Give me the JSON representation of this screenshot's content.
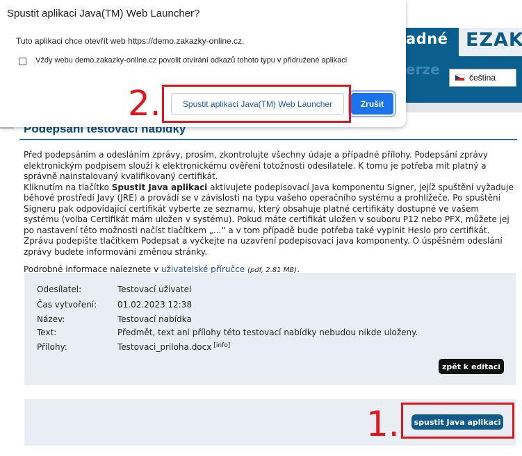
{
  "dialog": {
    "title": "Spustit aplikaci Java(TM) Web Launcher?",
    "message": "Tuto aplikaci chce otevřít web https://demo.zakazky-online.cz.",
    "checkbox_label": "Vždy webu demo.zakazky-online.cz povolit otvírání odkazů tohoto typu v přidružené aplikaci",
    "checkbox_checked": false,
    "open_button": "Spustit aplikaci Java(TM) Web Launcher",
    "cancel_button": "Zrušit"
  },
  "header": {
    "title_fragment": "adné",
    "subtitle_fragment": "erze",
    "logo_text": "EZAK",
    "language": "čeština"
  },
  "page": {
    "title": "Podepsání testovací nabídky",
    "intro": "Před podepsáním a odesláním zprávy, prosím, zkontrolujte všechny údaje a případné přílohy. Podepsání zprávy elektronickým podpisem slouží k elektronickému ověření totožnosti odesilatele. K tomu je potřeba mít platný a správně nainstalovaný kvalifikovaný certifikát.",
    "instr_before": "Kliknutím na tlačítko ",
    "instr_bold": "Spustit Java aplikaci",
    "instr_after": " aktivujete podepisovací Java komponentu Signer, jejíž spuštění vyžaduje běhové prostředí Javy (JRE) a provádí se v závislosti na typu vašeho operačního systému a prohlížeče. Po spuštění Signeru pak odpovídající certifikát vyberte ze seznamu, který obsahuje platné certifikáty dostupné ve vašem systému (volba Certifikát mám uložen v systému). Pokud máte certifikát uložen v souboru P12 nebo PFX, můžete jej po nastavení této možnosti načíst tlačítkem „...“ a v tom případě bude potřeba také vyplnit Heslo pro certifikát. Zprávu podepište tlačítkem Podepsat a vyčkejte na uzavření podepisovací java komponenty. O úspěšném odeslání zprávy budete informováni změnou stránky.",
    "more_before": "Podrobné informace naleznete v ",
    "more_link": "uživatelské příručce",
    "more_meta": "(pdf, 2.81 MB)",
    "more_end": "."
  },
  "details": {
    "rows": [
      {
        "label": "Odesílatel:",
        "value": "Testovací uživatel"
      },
      {
        "label": "Čas vytvoření:",
        "value": "01.02.2023 12:38"
      },
      {
        "label": "Název:",
        "value": "Testovací nabídka"
      },
      {
        "label": "Text:",
        "value": "Předmět, text ani přílohy této testovací nabídky nebudou nikde uloženy."
      },
      {
        "label": "Přílohy:",
        "value": "Testovaci_priloha.docx"
      }
    ],
    "info_link": "[info]",
    "back_button": "zpět k editaci"
  },
  "actions": {
    "run_button": "spustit Java aplikaci"
  },
  "annotations": {
    "step1": "1.",
    "step2": "2."
  },
  "colors": {
    "header_blue": "#0a5f8f",
    "title_blue": "#0d4f7e",
    "panel_bg": "#e8eef3",
    "annotation_red": "#e2141c",
    "dialog_primary": "#1a73e8"
  }
}
